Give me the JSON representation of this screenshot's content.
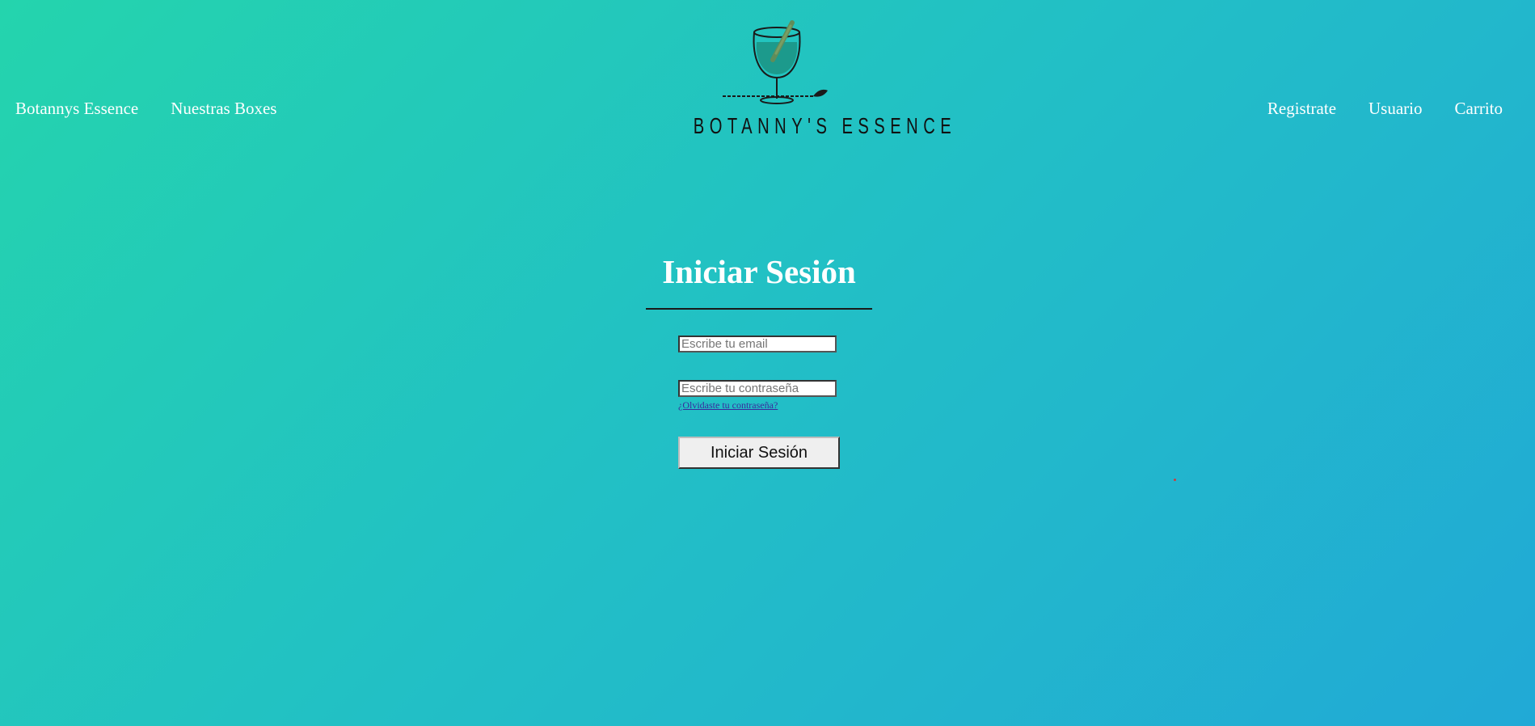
{
  "nav": {
    "left": [
      "Botannys Essence",
      "Nuestras Boxes"
    ],
    "right": [
      "Registrate",
      "Usuario",
      "Carrito"
    ]
  },
  "logo": {
    "text": "BOTANNY'S ESSENCE",
    "icon": "cocktail-glass-icon"
  },
  "login": {
    "title": "Iniciar Sesión",
    "email_placeholder": "Escribe tu email",
    "email_value": "",
    "password_placeholder": "Escribe tu contraseña",
    "password_value": "",
    "forgot_link": "¿Olvidaste tu contraseña?",
    "submit_label": "Iniciar Sesión"
  },
  "colors": {
    "gradient_start": "#24d4ad",
    "gradient_end": "#21a9d6",
    "link": "#3a2a9c"
  }
}
